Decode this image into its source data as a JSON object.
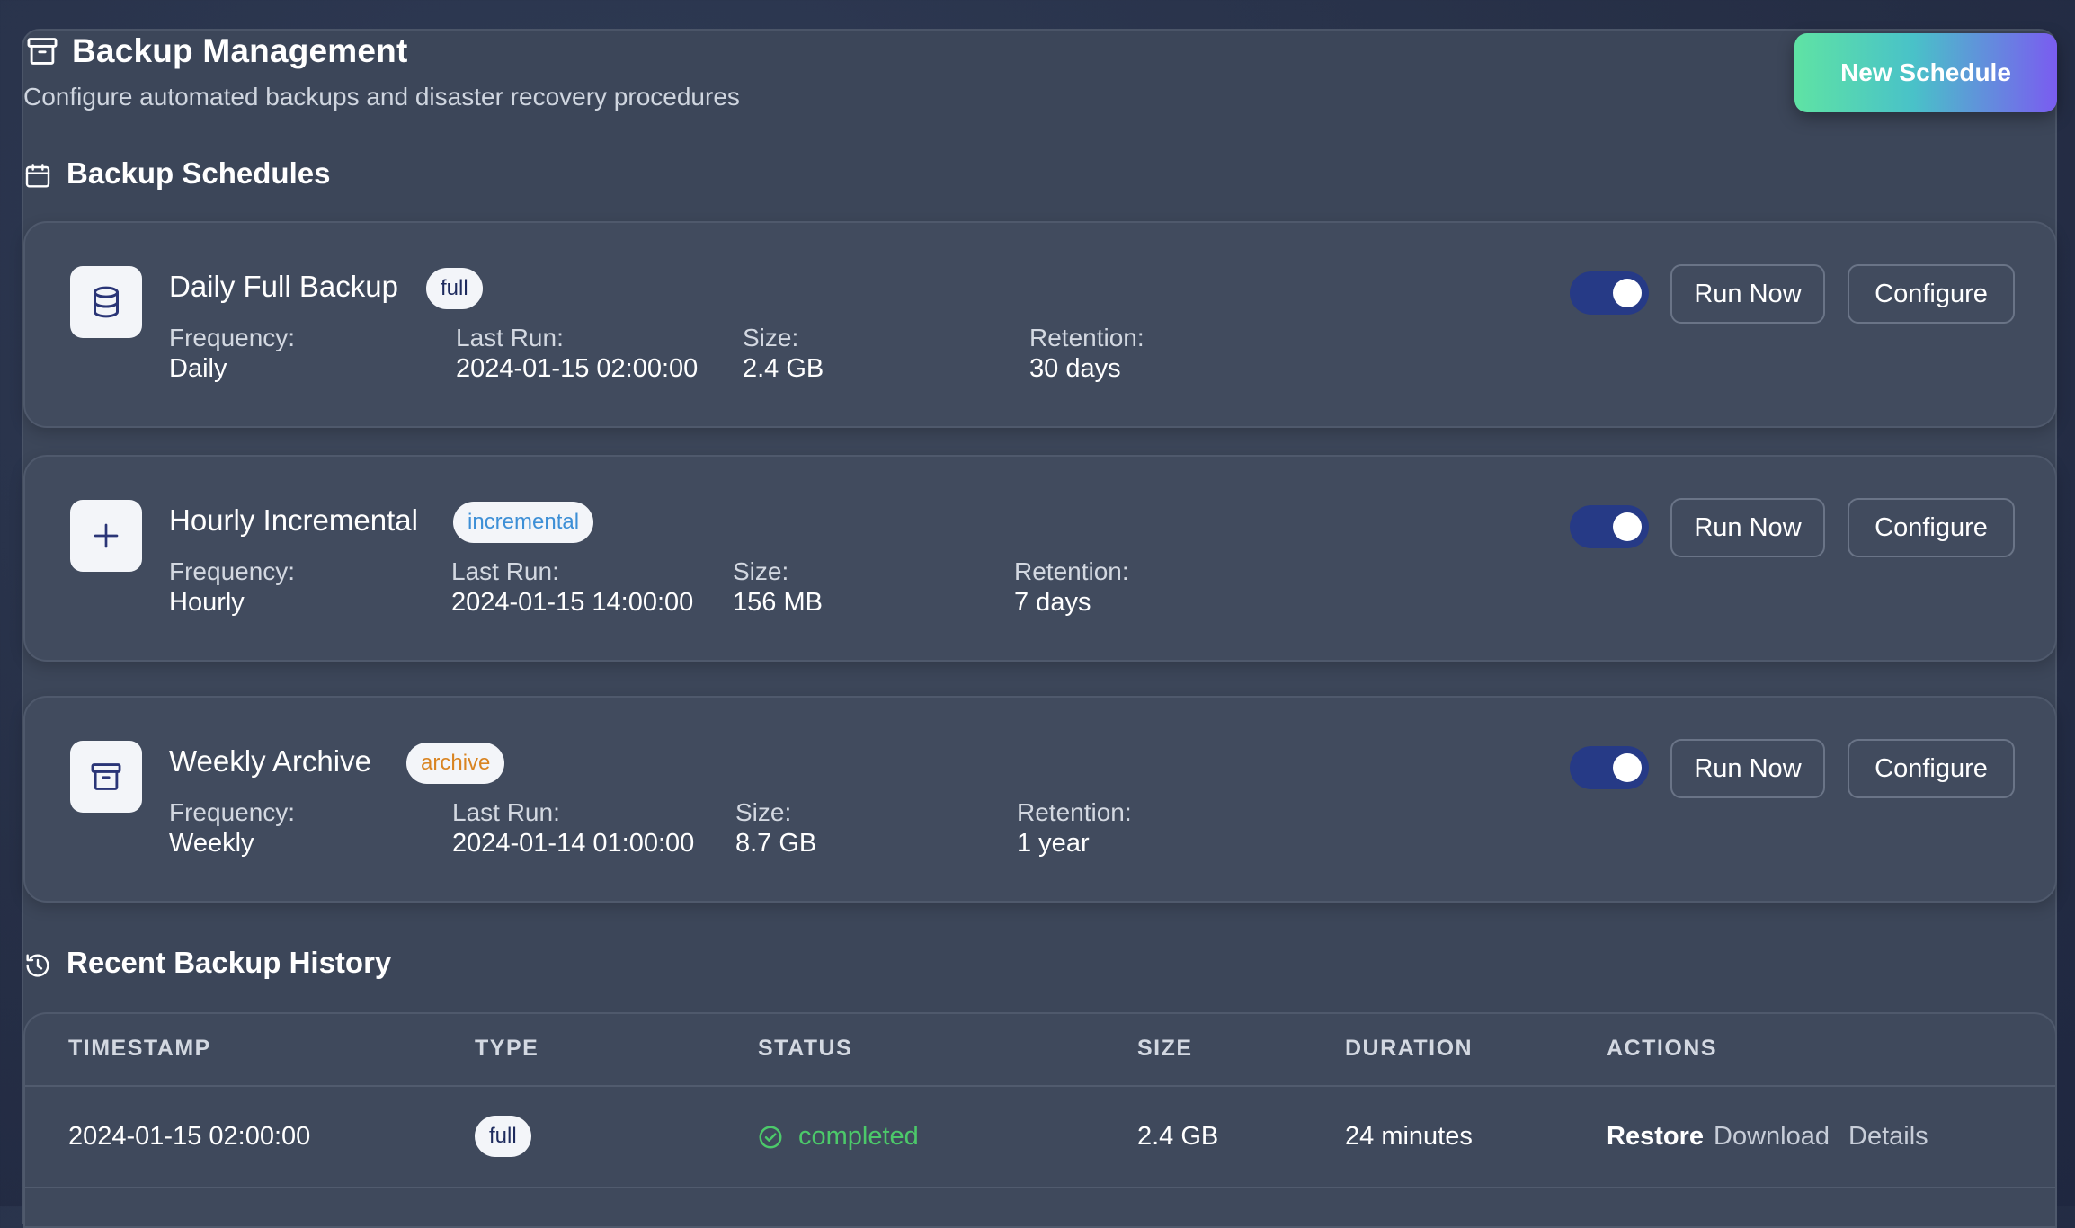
{
  "header": {
    "title": "Backup Management",
    "subtitle": "Configure automated backups and disaster recovery procedures",
    "new_schedule_label": "New Schedule"
  },
  "schedules_section": {
    "title": "Backup Schedules"
  },
  "schedules": [
    {
      "name": "Daily Full Backup",
      "type": "full",
      "icon": "database-icon",
      "frequency_label": "Frequency:",
      "frequency": "Daily",
      "last_run_label": "Last Run:",
      "last_run": "2024-01-15 02:00:00",
      "size_label": "Size:",
      "size": "2.4 GB",
      "retention_label": "Retention:",
      "retention": "30 days",
      "enabled": true,
      "run_now_label": "Run Now",
      "configure_label": "Configure"
    },
    {
      "name": "Hourly Incremental",
      "type": "incremental",
      "icon": "plus-icon",
      "frequency_label": "Frequency:",
      "frequency": "Hourly",
      "last_run_label": "Last Run:",
      "last_run": "2024-01-15 14:00:00",
      "size_label": "Size:",
      "size": "156 MB",
      "retention_label": "Retention:",
      "retention": "7 days",
      "enabled": true,
      "run_now_label": "Run Now",
      "configure_label": "Configure"
    },
    {
      "name": "Weekly Archive",
      "type": "archive",
      "icon": "archive-icon",
      "frequency_label": "Frequency:",
      "frequency": "Weekly",
      "last_run_label": "Last Run:",
      "last_run": "2024-01-14 01:00:00",
      "size_label": "Size:",
      "size": "8.7 GB",
      "retention_label": "Retention:",
      "retention": "1 year",
      "enabled": true,
      "run_now_label": "Run Now",
      "configure_label": "Configure"
    }
  ],
  "history_section": {
    "title": "Recent Backup History",
    "columns": [
      "TIMESTAMP",
      "TYPE",
      "STATUS",
      "SIZE",
      "DURATION",
      "ACTIONS"
    ],
    "rows": [
      {
        "timestamp": "2024-01-15 02:00:00",
        "type": "full",
        "status": "completed",
        "size": "2.4 GB",
        "duration": "24 minutes",
        "actions": [
          "Restore",
          "Download",
          "Details"
        ]
      }
    ]
  },
  "colors": {
    "badge_full": "#1e2b5e",
    "badge_incremental": "#3d8fd6",
    "badge_archive": "#d98422",
    "status_completed": "#4cc96a",
    "toggle_on": "#263a86"
  }
}
